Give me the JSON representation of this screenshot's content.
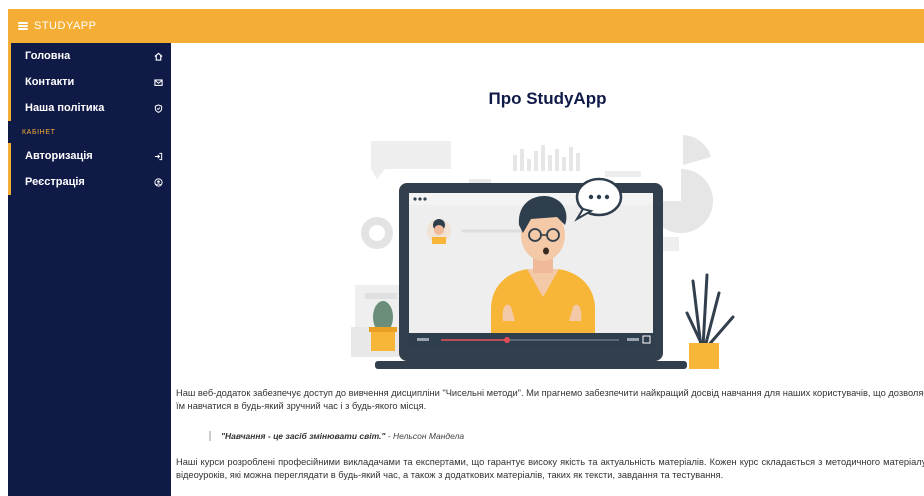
{
  "header": {
    "brand": "STUDYAPP"
  },
  "sidebar": {
    "items": [
      {
        "label": "Головна",
        "icon": "home-icon"
      },
      {
        "label": "Контакти",
        "icon": "mail-icon"
      },
      {
        "label": "Наша політика",
        "icon": "shield-icon"
      }
    ],
    "section": "КАБІНЕТ",
    "cabinet_items": [
      {
        "label": "Авторизація",
        "icon": "login-icon"
      },
      {
        "label": "Реєстрація",
        "icon": "register-icon"
      }
    ]
  },
  "main": {
    "title": "Про StudyApp",
    "paragraph1": "Наш веб-додаток забезпечує доступ до вивчення дисципліни \"Чисельні методи\". Ми прагнемо забезпечити найкращий досвід навчання для наших користувачів, що дозволяє їм навчатися в будь-який зручний час і з будь-якого місця.",
    "quote_text": "\"Навчання - це засіб змінювати світ.\"",
    "quote_author": " - Нельсон Мандела",
    "paragraph2": "Наші курси розроблені професійними викладачами та експертами, що гарантує високу якість та актуальність матеріалів. Кожен курс складається з методичного матеріалу, відеоуроків, які можна переглядати в будь-який час, а також з додаткових матеріалів, таких як тексти, завдання та тестування."
  },
  "colors": {
    "accent": "#f5ae35",
    "sidebar": "#101a47"
  }
}
